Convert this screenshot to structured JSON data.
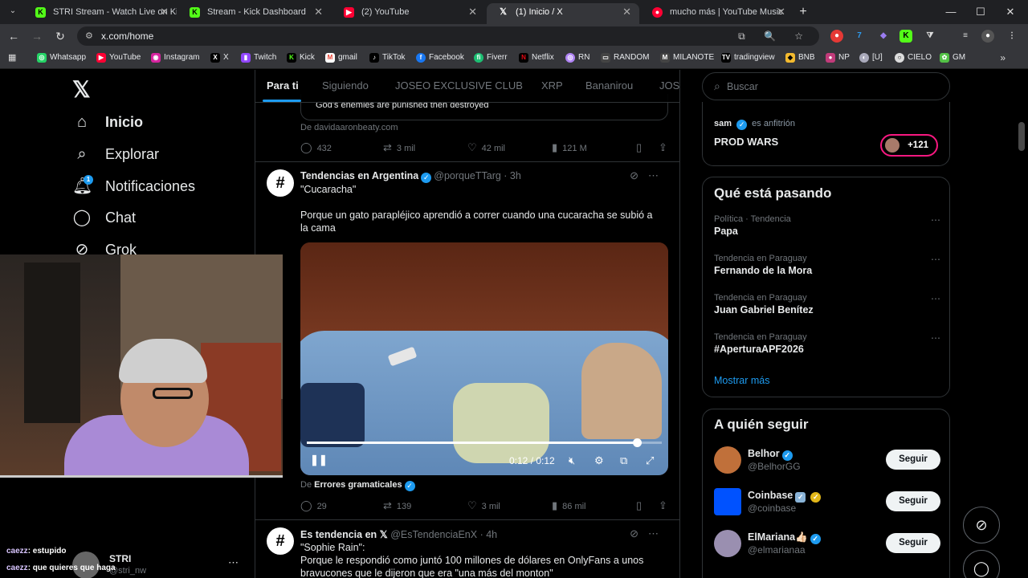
{
  "browser": {
    "tabs": [
      {
        "title": "STRI Stream - Watch Live on Kick",
        "icon": "kick-logo",
        "color": "#53fc18"
      },
      {
        "title": "Stream - Kick Dashboard",
        "icon": "kick-logo",
        "color": "#53fc18"
      },
      {
        "title": "(2) YouTube",
        "icon": "youtube-logo",
        "color": "#ff0033"
      },
      {
        "title": "(1) Inicio / X",
        "icon": "x-logo",
        "color": "#ffffff"
      },
      {
        "title": "mucho más | YouTube Music",
        "icon": "youtube-music-logo",
        "color": "#ff0033"
      }
    ],
    "url": "x.com/home",
    "bookmarks": [
      "Whatsapp",
      "YouTube",
      "Instagram",
      "X",
      "Twitch",
      "Kick",
      "gmail",
      "TikTok",
      "Facebook",
      "Fiverr",
      "Netflix",
      "RN",
      "RANDOM",
      "MILANOTE",
      "tradingview",
      "BNB",
      "NP",
      "[U]",
      "CIELO",
      "GM"
    ]
  },
  "x": {
    "nav": [
      {
        "label": "Inicio",
        "icon": "home-icon"
      },
      {
        "label": "Explorar",
        "icon": "search-icon"
      },
      {
        "label": "Notificaciones",
        "icon": "bell-icon",
        "badge": "1"
      },
      {
        "label": "Chat",
        "icon": "chat-icon"
      },
      {
        "label": "Grok",
        "icon": "grok-icon"
      }
    ],
    "account": {
      "name": "STRI",
      "handle": "@stri_nw"
    },
    "feed_tabs": [
      "Para ti",
      "Siguiendo",
      "JOSEO EXCLUSIVE CLUB",
      "XRP",
      "Bananirou",
      "JOS"
    ],
    "quoted_text": "God's enemies are punished then destroyed",
    "post1": {
      "from": "De davidaaronbeaty.com",
      "replies": "432",
      "reposts": "3 mil",
      "likes": "42 mil",
      "views": "121 M"
    },
    "post2": {
      "name": "Tendencias en Argentina",
      "handle": "@porqueTTarg · 3h",
      "title": "\"Cucaracha\"",
      "text": "Porque un gato parapléjico aprendió a correr cuando una cucaracha se subió a la cama",
      "video_time": "0:12 / 0:12",
      "video_progress": 0.93,
      "from_prefix": "De",
      "from_name": "Errores gramaticales",
      "replies": "29",
      "reposts": "139",
      "likes": "3 mil",
      "views": "86 mil"
    },
    "post3": {
      "name": "Es tendencia en 𝕏",
      "handle": "@EsTendenciaEnX · 4h",
      "title": "\"Sophie Rain\":",
      "text": "Porque le respondió como juntó 100 millones de dólares en OnlyFans a unos bravucones que le dijeron que era \"una más del monton\""
    },
    "search_placeholder": "Buscar",
    "space": {
      "host_name": "sam",
      "host_suffix": "es anfitrión",
      "title": "PROD WARS",
      "listeners": "+121"
    },
    "trending_title": "Qué está pasando",
    "trends": [
      {
        "category": "Política · Tendencia",
        "topic": "Papa"
      },
      {
        "category": "Tendencia en Paraguay",
        "topic": "Fernando de la Mora"
      },
      {
        "category": "Tendencia en Paraguay",
        "topic": "Juan Gabriel Benítez"
      },
      {
        "category": "Tendencia en Paraguay",
        "topic": "#AperturaAPF2026"
      }
    ],
    "show_more": "Mostrar más",
    "who_title": "A quién seguir",
    "who": [
      {
        "name": "Belhor",
        "handle": "@BelhorGG",
        "color": "#c0703a"
      },
      {
        "name": "Coinbase",
        "handle": "@coinbase",
        "color": "#0052ff"
      },
      {
        "name": "ElMariana👍🏻",
        "handle": "@elmarianaa",
        "color": "#9a8fb0"
      }
    ],
    "follow_label": "Seguir"
  },
  "stream_chat": [
    {
      "user": "caezz",
      "text": ": estupido"
    },
    {
      "user": "caezz",
      "text": ": que quieres que haga"
    }
  ]
}
